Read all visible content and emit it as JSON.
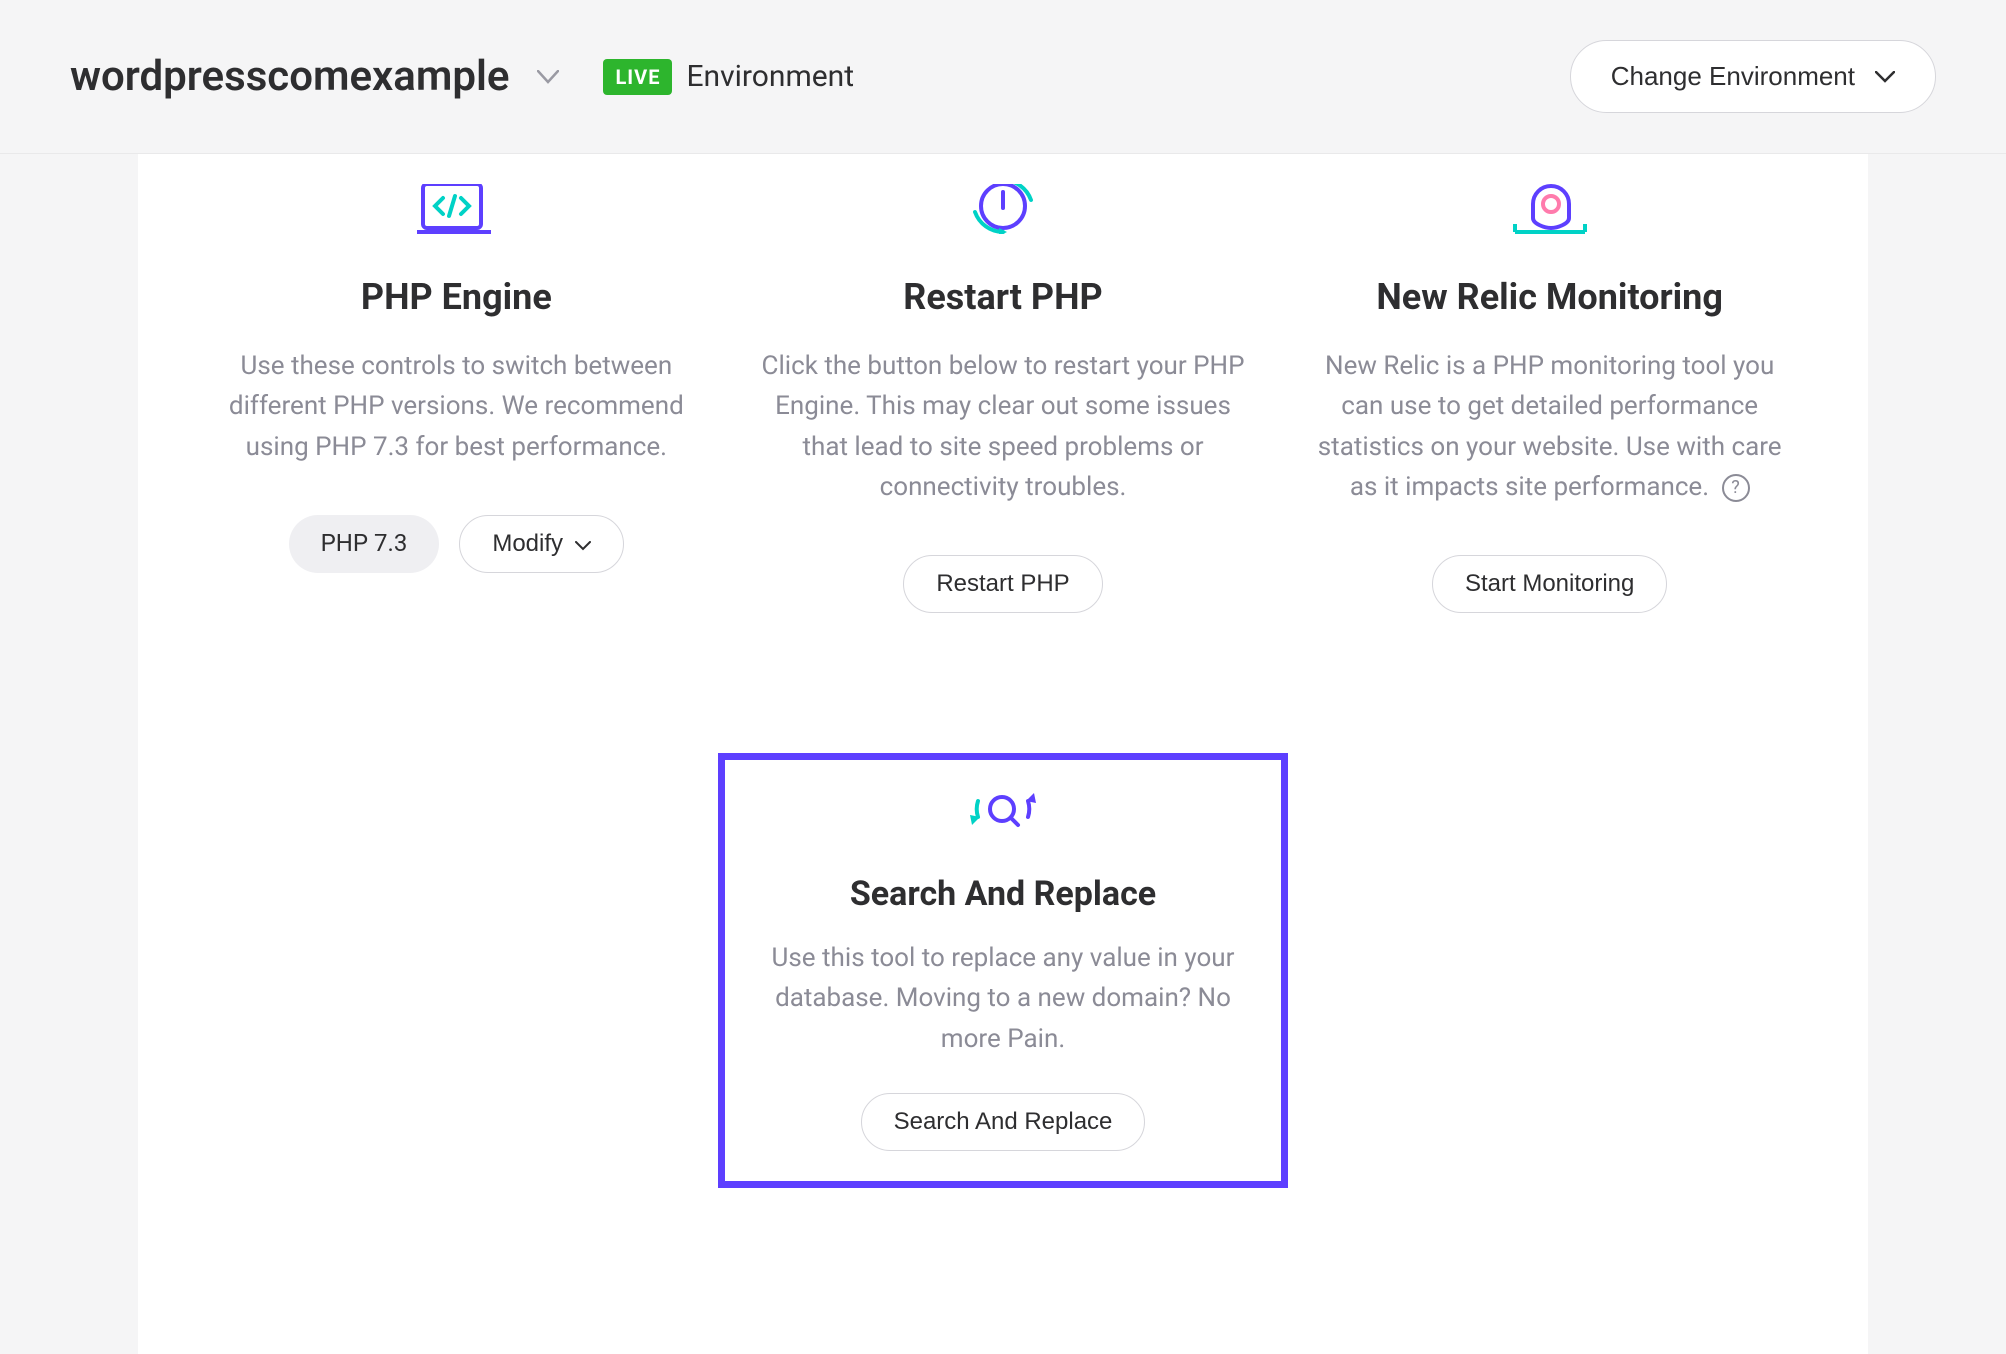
{
  "header": {
    "site_name": "wordpresscomexample",
    "live_badge": "LIVE",
    "env_label": "Environment",
    "change_env": "Change Environment"
  },
  "cards": {
    "php_engine": {
      "title": "PHP Engine",
      "desc": "Use these controls to switch between different PHP versions. We recommend using PHP 7.3 for best performance.",
      "version_badge": "PHP 7.3",
      "modify_label": "Modify"
    },
    "restart_php": {
      "title": "Restart PHP",
      "desc": "Click the button below to restart your PHP Engine. This may clear out some issues that lead to site speed problems or connectivity troubles.",
      "button": "Restart PHP"
    },
    "new_relic": {
      "title": "New Relic Monitoring",
      "desc": "New Relic is a PHP monitoring tool you can use to get detailed performance statistics on your website. Use with care as it impacts site performance.",
      "button": "Start Monitoring"
    },
    "search_replace": {
      "title": "Search And Replace",
      "desc": "Use this tool to replace any value in your database. Moving to a new domain? No more Pain.",
      "button": "Search And Replace"
    }
  }
}
